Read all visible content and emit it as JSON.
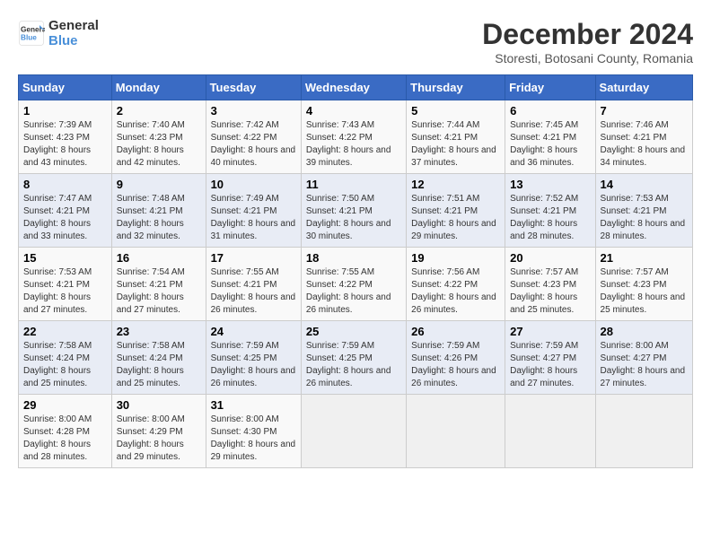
{
  "logo": {
    "line1": "General",
    "line2": "Blue"
  },
  "title": "December 2024",
  "subtitle": "Storesti, Botosani County, Romania",
  "days_of_week": [
    "Sunday",
    "Monday",
    "Tuesday",
    "Wednesday",
    "Thursday",
    "Friday",
    "Saturday"
  ],
  "weeks": [
    [
      {
        "day": "1",
        "sunrise": "7:39 AM",
        "sunset": "4:23 PM",
        "daylight": "8 hours and 43 minutes."
      },
      {
        "day": "2",
        "sunrise": "7:40 AM",
        "sunset": "4:23 PM",
        "daylight": "8 hours and 42 minutes."
      },
      {
        "day": "3",
        "sunrise": "7:42 AM",
        "sunset": "4:22 PM",
        "daylight": "8 hours and 40 minutes."
      },
      {
        "day": "4",
        "sunrise": "7:43 AM",
        "sunset": "4:22 PM",
        "daylight": "8 hours and 39 minutes."
      },
      {
        "day": "5",
        "sunrise": "7:44 AM",
        "sunset": "4:21 PM",
        "daylight": "8 hours and 37 minutes."
      },
      {
        "day": "6",
        "sunrise": "7:45 AM",
        "sunset": "4:21 PM",
        "daylight": "8 hours and 36 minutes."
      },
      {
        "day": "7",
        "sunrise": "7:46 AM",
        "sunset": "4:21 PM",
        "daylight": "8 hours and 34 minutes."
      }
    ],
    [
      {
        "day": "8",
        "sunrise": "7:47 AM",
        "sunset": "4:21 PM",
        "daylight": "8 hours and 33 minutes."
      },
      {
        "day": "9",
        "sunrise": "7:48 AM",
        "sunset": "4:21 PM",
        "daylight": "8 hours and 32 minutes."
      },
      {
        "day": "10",
        "sunrise": "7:49 AM",
        "sunset": "4:21 PM",
        "daylight": "8 hours and 31 minutes."
      },
      {
        "day": "11",
        "sunrise": "7:50 AM",
        "sunset": "4:21 PM",
        "daylight": "8 hours and 30 minutes."
      },
      {
        "day": "12",
        "sunrise": "7:51 AM",
        "sunset": "4:21 PM",
        "daylight": "8 hours and 29 minutes."
      },
      {
        "day": "13",
        "sunrise": "7:52 AM",
        "sunset": "4:21 PM",
        "daylight": "8 hours and 28 minutes."
      },
      {
        "day": "14",
        "sunrise": "7:53 AM",
        "sunset": "4:21 PM",
        "daylight": "8 hours and 28 minutes."
      }
    ],
    [
      {
        "day": "15",
        "sunrise": "7:53 AM",
        "sunset": "4:21 PM",
        "daylight": "8 hours and 27 minutes."
      },
      {
        "day": "16",
        "sunrise": "7:54 AM",
        "sunset": "4:21 PM",
        "daylight": "8 hours and 27 minutes."
      },
      {
        "day": "17",
        "sunrise": "7:55 AM",
        "sunset": "4:21 PM",
        "daylight": "8 hours and 26 minutes."
      },
      {
        "day": "18",
        "sunrise": "7:55 AM",
        "sunset": "4:22 PM",
        "daylight": "8 hours and 26 minutes."
      },
      {
        "day": "19",
        "sunrise": "7:56 AM",
        "sunset": "4:22 PM",
        "daylight": "8 hours and 26 minutes."
      },
      {
        "day": "20",
        "sunrise": "7:57 AM",
        "sunset": "4:23 PM",
        "daylight": "8 hours and 25 minutes."
      },
      {
        "day": "21",
        "sunrise": "7:57 AM",
        "sunset": "4:23 PM",
        "daylight": "8 hours and 25 minutes."
      }
    ],
    [
      {
        "day": "22",
        "sunrise": "7:58 AM",
        "sunset": "4:24 PM",
        "daylight": "8 hours and 25 minutes."
      },
      {
        "day": "23",
        "sunrise": "7:58 AM",
        "sunset": "4:24 PM",
        "daylight": "8 hours and 25 minutes."
      },
      {
        "day": "24",
        "sunrise": "7:59 AM",
        "sunset": "4:25 PM",
        "daylight": "8 hours and 26 minutes."
      },
      {
        "day": "25",
        "sunrise": "7:59 AM",
        "sunset": "4:25 PM",
        "daylight": "8 hours and 26 minutes."
      },
      {
        "day": "26",
        "sunrise": "7:59 AM",
        "sunset": "4:26 PM",
        "daylight": "8 hours and 26 minutes."
      },
      {
        "day": "27",
        "sunrise": "7:59 AM",
        "sunset": "4:27 PM",
        "daylight": "8 hours and 27 minutes."
      },
      {
        "day": "28",
        "sunrise": "8:00 AM",
        "sunset": "4:27 PM",
        "daylight": "8 hours and 27 minutes."
      }
    ],
    [
      {
        "day": "29",
        "sunrise": "8:00 AM",
        "sunset": "4:28 PM",
        "daylight": "8 hours and 28 minutes."
      },
      {
        "day": "30",
        "sunrise": "8:00 AM",
        "sunset": "4:29 PM",
        "daylight": "8 hours and 29 minutes."
      },
      {
        "day": "31",
        "sunrise": "8:00 AM",
        "sunset": "4:30 PM",
        "daylight": "8 hours and 29 minutes."
      },
      null,
      null,
      null,
      null
    ]
  ],
  "labels": {
    "sunrise": "Sunrise:",
    "sunset": "Sunset:",
    "daylight": "Daylight:"
  }
}
